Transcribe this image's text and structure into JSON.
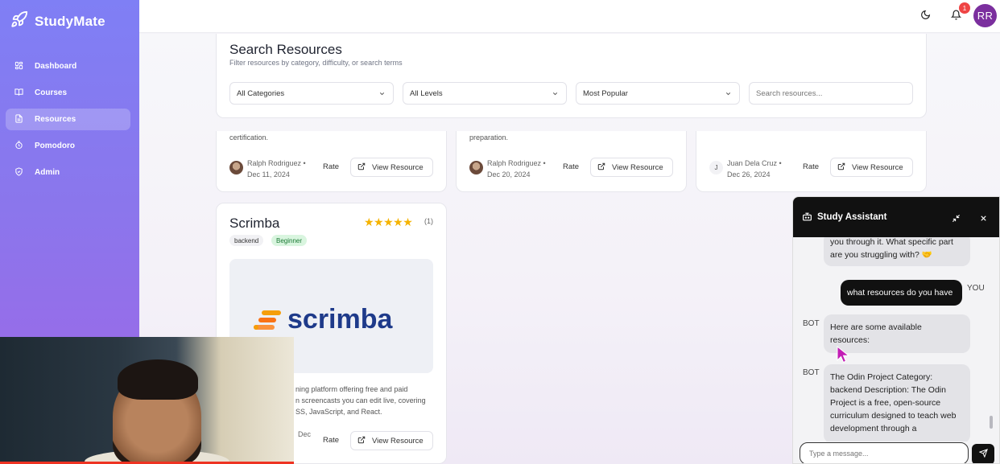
{
  "app": {
    "name": "StudyMate",
    "logo_icon": "rocket-icon"
  },
  "sidebar": {
    "items": [
      {
        "label": "Dashboard",
        "icon": "dashboard-icon",
        "active": false
      },
      {
        "label": "Courses",
        "icon": "book-icon",
        "active": false
      },
      {
        "label": "Resources",
        "icon": "document-icon",
        "active": true
      },
      {
        "label": "Pomodoro",
        "icon": "timer-icon",
        "active": false
      },
      {
        "label": "Admin",
        "icon": "shield-icon",
        "active": false
      }
    ]
  },
  "topbar": {
    "theme_icon": "moon-icon",
    "notifications_count": "1",
    "avatar_initials": "RR",
    "avatar_color": "#7b2f9e"
  },
  "search": {
    "title": "Search Resources",
    "subtitle": "Filter resources by category, difficulty, or search terms",
    "category": "All Categories",
    "level": "All Levels",
    "sort": "Most Popular",
    "placeholder": "Search resources..."
  },
  "resource_cards": [
    {
      "desc_tail": "certification.",
      "author": "Ralph Rodriguez •",
      "date": "Dec 11, 2024",
      "rate_label": "Rate",
      "view_label": "View Resource"
    },
    {
      "desc_tail": "preparation.",
      "author": "Ralph Rodriguez •",
      "date": "Dec 20, 2024",
      "rate_label": "Rate",
      "view_label": "View Resource"
    },
    {
      "desc_tail": "",
      "author_initial": "J",
      "author": "Juan Dela Cruz •",
      "date": "Dec 26, 2024",
      "rate_label": "Rate",
      "view_label": "View Resource"
    }
  ],
  "scrimba_card": {
    "title": "Scrimba",
    "stars": "★★★★★",
    "rating_count": "(1)",
    "category": "backend",
    "level": "Beginner",
    "logo_text": "scrimba",
    "desc_lines": [
      "ning platform offering free and paid",
      "n screencasts you can edit live, covering",
      "SS, JavaScript, and React."
    ],
    "date_fragment": "Dec",
    "rate_label": "Rate",
    "view_label": "View Resource"
  },
  "chat": {
    "title": "Study Assistant",
    "messages": [
      {
        "role": "bot",
        "lines": [
          "you through it. What specific part",
          "are you struggling with? 🤝"
        ]
      },
      {
        "role": "user",
        "who": "YOU",
        "lines": [
          "what resources do you have"
        ]
      },
      {
        "role": "bot",
        "who": "BOT",
        "lines": [
          "Here are some available",
          "resources:"
        ]
      },
      {
        "role": "bot",
        "who": "BOT",
        "lines": [
          "The Odin Project Category:",
          "backend Description: The Odin",
          "Project is a free, open-source",
          "curriculum designed to teach web",
          "development through a"
        ]
      }
    ],
    "input_placeholder": "Type a message..."
  }
}
